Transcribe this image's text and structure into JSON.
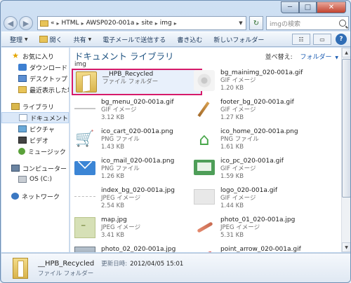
{
  "window": {
    "controls": {
      "minimize": "─",
      "maximize": "□",
      "close": "✕"
    }
  },
  "address_bar": {
    "back_glyph": "◀",
    "forward_glyph": "▶",
    "overflow": "«",
    "segments": [
      "HTML",
      "AWSP020-001a",
      "site",
      "img"
    ],
    "separator": "▸",
    "refresh_glyph": "↻"
  },
  "search": {
    "placeholder": "imgの検索"
  },
  "command_bar": {
    "organize": "整理",
    "open": "開く",
    "share": "共有",
    "email": "電子メールで送信する",
    "burn": "書き込む",
    "new_folder": "新しいフォルダー",
    "view_glyph": "☷",
    "pane_glyph": "▭",
    "help": "?"
  },
  "nav_pane": {
    "favorites": {
      "label": "お気に入り",
      "items": [
        "ダウンロード",
        "デスクトップ",
        "最近表示した場所"
      ]
    },
    "libraries": {
      "label": "ライブラリ",
      "items": [
        "ドキュメント",
        "ピクチャ",
        "ビデオ",
        "ミュージック"
      ]
    },
    "computer": {
      "label": "コンピューター",
      "items": [
        "OS (C:)"
      ]
    },
    "network": {
      "label": "ネットワーク"
    }
  },
  "content": {
    "library_title": "ドキュメント ライブラリ",
    "library_subtitle": "img",
    "sort_label": "並べ替え:",
    "sort_value": "フォルダー",
    "files": [
      {
        "name": "__HPB_Recycled",
        "type": "ファイル フォルダー",
        "size": "",
        "thumb": "folder",
        "selected": true
      },
      {
        "name": "bg_mainimg_020-001a.gif",
        "type": "GIF イメージ",
        "size": "1.20 KB",
        "thumb": "blur"
      },
      {
        "name": "bg_menu_020-001a.gif",
        "type": "GIF イメージ",
        "size": "3.12 KB",
        "thumb": "line"
      },
      {
        "name": "footer_bg_020-001a.gif",
        "type": "GIF イメージ",
        "size": "1.27 KB",
        "thumb": "pencil"
      },
      {
        "name": "ico_cart_020-001a.png",
        "type": "PNG ファイル",
        "size": "1.43 KB",
        "thumb": "cart"
      },
      {
        "name": "ico_home_020-001a.png",
        "type": "PNG ファイル",
        "size": "1.61 KB",
        "thumb": "home"
      },
      {
        "name": "ico_mail_020-001a.png",
        "type": "PNG ファイル",
        "size": "1.26 KB",
        "thumb": "mail"
      },
      {
        "name": "ico_pc_020-001a.gif",
        "type": "GIF イメージ",
        "size": "1.59 KB",
        "thumb": "pc"
      },
      {
        "name": "index_bg_020-001a.jpg",
        "type": "JPEG イメージ",
        "size": "2.54 KB",
        "thumb": "dash"
      },
      {
        "name": "logo_020-001a.gif",
        "type": "GIF イメージ",
        "size": "1.44 KB",
        "thumb": "gray"
      },
      {
        "name": "map.jpg",
        "type": "JPEG イメージ",
        "size": "3.41 KB",
        "thumb": "map"
      },
      {
        "name": "photo_01_020-001a.jpg",
        "type": "JPEG イメージ",
        "size": "5.31 KB",
        "thumb": "brush"
      },
      {
        "name": "photo_02_020-001a.jpg",
        "type": "",
        "size": "",
        "thumb": "photo"
      },
      {
        "name": "point_arrow_020-001a.gif",
        "type": "",
        "size": "",
        "thumb": "arrow"
      }
    ]
  },
  "details_pane": {
    "name": "__HPB_Recycled",
    "date_label": "更新日時:",
    "date_value": "2012/04/05 15:01",
    "type": "ファイル フォルダー"
  },
  "colors": {
    "highlight_border": "#d61a6a",
    "library_title": "#1c5180",
    "sort_value": "#1c5db3"
  }
}
